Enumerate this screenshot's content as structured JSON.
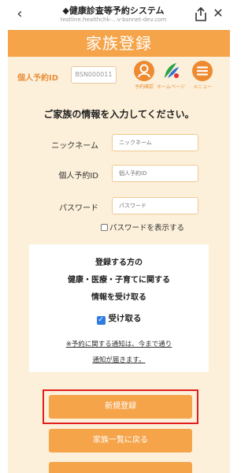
{
  "browser": {
    "back_icon": "chevron-left-icon",
    "title": "◆健康診査等予約システム",
    "url": "testline.healthchk-...v-bsnnet-dev.com",
    "share_icon": "share-icon",
    "close_icon": "close-icon"
  },
  "header": {
    "title": "家族登録"
  },
  "reservation": {
    "label": "個人予約ID",
    "value": "BSN000011"
  },
  "nav_icons": [
    {
      "icon": "user-icon",
      "label": "予約確認"
    },
    {
      "icon": "leaf-logo-icon",
      "label": "ホームページ"
    },
    {
      "icon": "menu-icon",
      "label": "メニュー"
    }
  ],
  "form": {
    "heading": "ご家族の情報を入力してください。",
    "nickname_label": "ニックネーム",
    "nickname_placeholder": "ニックネーム",
    "id_label": "個人予約ID",
    "id_placeholder": "個人予約ID",
    "password_label": "パスワード",
    "password_placeholder": "パスワード",
    "show_password_label": "パスワードを表示する"
  },
  "notice": {
    "line1": "登録する方の",
    "line2": "健康・医療・子育てに関する",
    "line3": "情報を受け取る",
    "receive_label": "受け取る",
    "note_line1": "※予約に関する通知は、今まで通り",
    "note_line2": "通知が届きます。"
  },
  "buttons": {
    "register": "新規登録",
    "back_to_list": "家族一覧に戻る"
  },
  "colors": {
    "accent": "#f5a44a",
    "background": "#fdf0da",
    "highlight": "#e02020",
    "checkbox": "#2f7de1"
  }
}
